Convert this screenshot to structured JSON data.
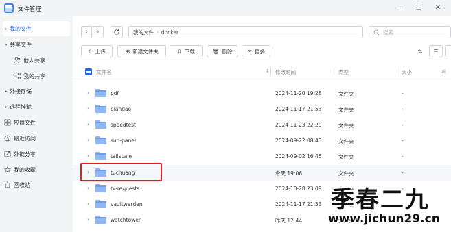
{
  "app": {
    "title": "文件管理"
  },
  "window": {
    "minimize": "—",
    "maximize": "☐",
    "close": "✕"
  },
  "sidebar": {
    "items": [
      {
        "label": "我的文件",
        "icon": "caret-icon",
        "active": true
      },
      {
        "label": "共享文件",
        "icon": "caret-icon"
      },
      {
        "label": "他人共享",
        "icon": "people-icon"
      },
      {
        "label": "我的共享",
        "icon": "share-icon"
      },
      {
        "label": "外接存储",
        "icon": "caret-icon"
      },
      {
        "label": "远程挂载",
        "icon": "caret-icon"
      },
      {
        "label": "应用文件",
        "icon": "grid-icon"
      },
      {
        "label": "最近访问",
        "icon": "clock-icon"
      },
      {
        "label": "外链分享",
        "icon": "link-icon"
      },
      {
        "label": "我的收藏",
        "icon": "star-icon"
      },
      {
        "label": "回收站",
        "icon": "trash-icon"
      }
    ]
  },
  "path": {
    "crumbs": [
      "我的文件",
      "docker"
    ]
  },
  "search": {
    "placeholder": "搜索"
  },
  "toolbar": {
    "upload": "上传",
    "new_folder": "新建文件夹",
    "download": "下载",
    "delete": "删除",
    "more": "更多"
  },
  "columns": {
    "name": "文件名",
    "mtime": "修改时间",
    "type": "类型",
    "size": "大小"
  },
  "rows": [
    {
      "name": "pdf",
      "mtime": "2024-11-20 19:28",
      "type": "文件夹",
      "size": "-"
    },
    {
      "name": "qiandao",
      "mtime": "2024-11-17 21:53",
      "type": "文件夹",
      "size": "-"
    },
    {
      "name": "speedtest",
      "mtime": "2024-11-23 22:29",
      "type": "文件夹",
      "size": "-"
    },
    {
      "name": "sun-panel",
      "mtime": "2024-09-22 08:43",
      "type": "文件夹",
      "size": "-"
    },
    {
      "name": "tailscale",
      "mtime": "2024-09-02 16:45",
      "type": "文件夹",
      "size": "-"
    },
    {
      "name": "tuchuang",
      "mtime": "今天 19:06",
      "type": "文件夹",
      "size": "-",
      "highlighted": true
    },
    {
      "name": "tv-requests",
      "mtime": "2024-10-28 23:09",
      "type": "文件夹",
      "size": "-"
    },
    {
      "name": "vaultwarden",
      "mtime": "2024-11-17 21:53",
      "type": "文件夹",
      "size": "-"
    },
    {
      "name": "watchtower",
      "mtime": "昨天 12:44",
      "type": "文件夹",
      "size": "-"
    }
  ],
  "watermark": {
    "name": "季春二九",
    "url": "www.jichun29.cn"
  },
  "colors": {
    "accent": "#2563eb",
    "folder": "#6f9ee8",
    "highlight_box": "#e11d1d"
  }
}
